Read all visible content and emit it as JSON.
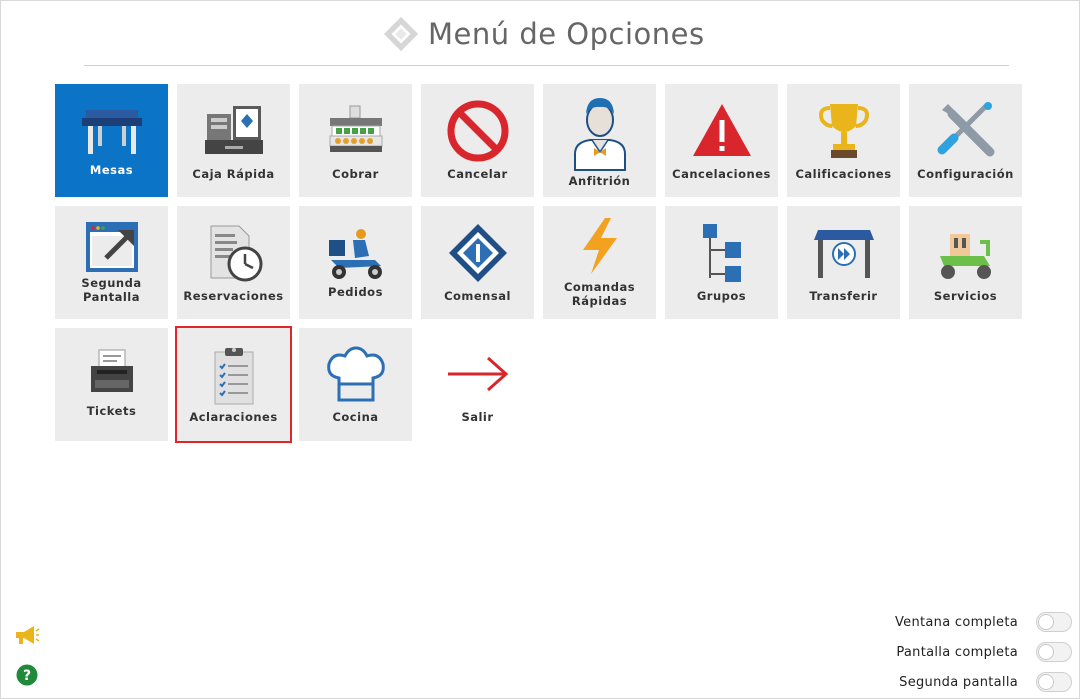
{
  "header": {
    "title": "Menú de Opciones",
    "logo_icon": "diamond-logo-icon"
  },
  "tiles": [
    {
      "id": "mesas",
      "label": "Mesas",
      "icon": "table-icon"
    },
    {
      "id": "caja",
      "label": "Caja Rápida",
      "icon": "cash-register-icon"
    },
    {
      "id": "cobrar",
      "label": "Cobrar",
      "icon": "cash-drawer-icon"
    },
    {
      "id": "cancelar",
      "label": "Cancelar",
      "icon": "prohibited-icon"
    },
    {
      "id": "anfitrion",
      "label": "Anfitrión",
      "icon": "host-icon"
    },
    {
      "id": "cancelaciones",
      "label": "Cancelaciones",
      "icon": "warning-icon"
    },
    {
      "id": "calificaciones",
      "label": "Calificaciones",
      "icon": "trophy-icon"
    },
    {
      "id": "configuracion",
      "label": "Configuración",
      "icon": "tools-icon"
    },
    {
      "id": "segunda",
      "label_line1": "Segunda",
      "label_line2": "Pantalla",
      "icon": "second-screen-icon"
    },
    {
      "id": "reservaciones",
      "label": "Reservaciones",
      "icon": "reservation-clock-icon"
    },
    {
      "id": "pedidos",
      "label": "Pedidos",
      "icon": "delivery-scooter-icon"
    },
    {
      "id": "comensal",
      "label": "Comensal",
      "icon": "diner-icon"
    },
    {
      "id": "comandas",
      "label_line1": "Comandas",
      "label_line2": "Rápidas",
      "icon": "lightning-icon"
    },
    {
      "id": "grupos",
      "label": "Grupos",
      "icon": "groups-tree-icon"
    },
    {
      "id": "transferir",
      "label": "Transferir",
      "icon": "transfer-table-icon"
    },
    {
      "id": "servicios",
      "label": "Servicios",
      "icon": "service-scooter-icon"
    },
    {
      "id": "tickets",
      "label": "Tickets",
      "icon": "ticket-printer-icon"
    },
    {
      "id": "aclaraciones",
      "label": "Aclaraciones",
      "icon": "clipboard-checklist-icon"
    },
    {
      "id": "cocina",
      "label": "Cocina",
      "icon": "chef-hat-icon"
    },
    {
      "id": "salir",
      "label": "Salir",
      "icon": "arrow-right-icon"
    }
  ],
  "toggles": [
    {
      "label": "Ventana completa",
      "on": false
    },
    {
      "label": "Pantalla completa",
      "on": false
    },
    {
      "label": "Segunda pantalla",
      "on": false
    }
  ],
  "corner_icons": {
    "announcement": "megaphone-icon",
    "help": "help-icon"
  },
  "colors": {
    "active_tile": "#0b74c7",
    "tile_bg": "#ececec",
    "highlight_border": "#e0262b"
  }
}
